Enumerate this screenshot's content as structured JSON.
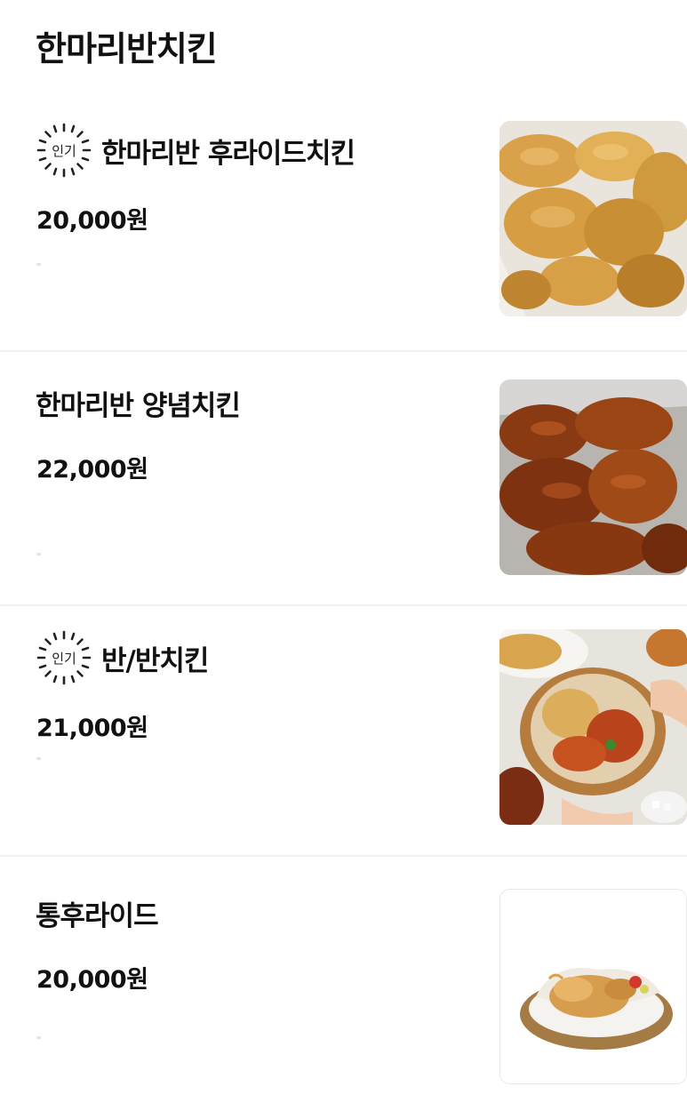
{
  "category": {
    "title": "한마리반치킨"
  },
  "badge": {
    "label": "인기"
  },
  "items": [
    {
      "name": "한마리반 후라이드치킨",
      "price": "20,000원",
      "popular": true,
      "image": "fried-chicken-photo"
    },
    {
      "name": "한마리반 양념치킨",
      "price": "22,000원",
      "popular": false,
      "image": "seasoned-chicken-photo"
    },
    {
      "name": "반/반치킨",
      "price": "21,000원",
      "popular": true,
      "image": "half-half-chicken-photo"
    },
    {
      "name": "통후라이드",
      "price": "20,000원",
      "popular": false,
      "image": "whole-fried-chicken-photo"
    }
  ]
}
